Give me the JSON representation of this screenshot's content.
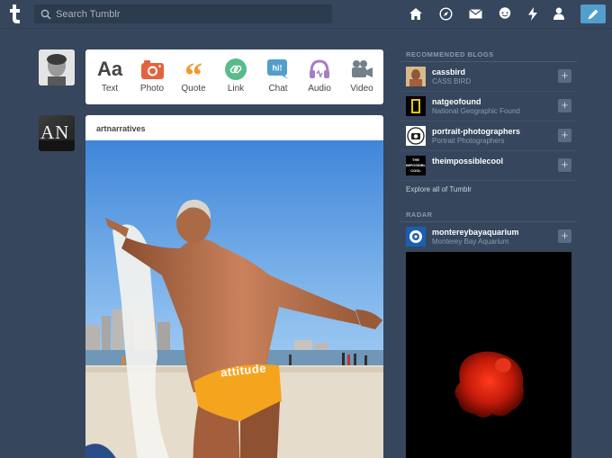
{
  "header": {
    "search_placeholder": "Search Tumblr",
    "nav_icons": [
      "home-icon",
      "explore-icon",
      "mail-icon",
      "chat-icon",
      "activity-icon",
      "account-icon"
    ],
    "accent_color": "#529ecc",
    "background_color": "#36465d"
  },
  "post_bar": {
    "items": [
      {
        "label": "Text",
        "icon": "text-icon",
        "color": "#444444"
      },
      {
        "label": "Photo",
        "icon": "camera-icon",
        "color": "#e2643f"
      },
      {
        "label": "Quote",
        "icon": "quote-icon",
        "color": "#f2992e"
      },
      {
        "label": "Link",
        "icon": "link-icon",
        "color": "#56bc8a"
      },
      {
        "label": "Chat",
        "icon": "chat-icon",
        "color": "#529ecc"
      },
      {
        "label": "Audio",
        "icon": "headphones-icon",
        "color": "#a77dc2"
      },
      {
        "label": "Video",
        "icon": "video-camera-icon",
        "color": "#748089"
      }
    ]
  },
  "post": {
    "blog_avatar_text": "AN",
    "blog_name": "artnarratives",
    "photo_text": "attitude"
  },
  "sidebar": {
    "recommended_heading": "RECOMMENDED BLOGS",
    "blogs": [
      {
        "name": "cassbird",
        "subtitle": "CASS BIRD"
      },
      {
        "name": "natgeofound",
        "subtitle": "National Geographic Found"
      },
      {
        "name": "portrait-photographers",
        "subtitle": "Portrait Photographers"
      },
      {
        "name": "theimpossiblecool",
        "subtitle": ""
      }
    ],
    "follow_label": "+",
    "impossible_avatar_text": [
      "THE",
      "IMPOSSIBLE",
      "COOL"
    ],
    "explore_label": "Explore all of Tumblr",
    "radar_heading": "RADAR",
    "radar_blog": {
      "name": "montereybayaquarium",
      "subtitle": "Monterey Bay Aquarium"
    }
  }
}
